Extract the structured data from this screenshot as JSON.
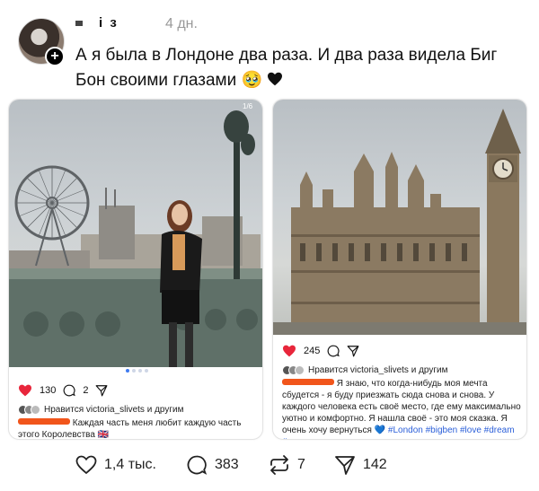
{
  "post": {
    "username": "і з",
    "time": "4 дн.",
    "text": "А я была в Лондоне два раза. И два раза видела Биг Бон своими глазами 🥹"
  },
  "left_card": {
    "likes": "130",
    "comments": "2",
    "liked_by": "Нравится victoria_slivets и другим",
    "caption": "Каждая часть меня любит каждую часть этого Королевства 🇬🇧",
    "photo_counter": "1/6"
  },
  "right_card": {
    "likes": "245",
    "liked_by": "Нравится victoria_slivets и другим",
    "caption": "Я знаю, что когда-нибудь моя мечта сбудется - я буду приезжать сюда снова и снова. У каждого человека есть своё место, где ему максимально уютно и комфортно. Я нашла своё - это моя сказка. Я очень хочу вернуться 💙",
    "tags": "#London #bigben #love #dream #vsco"
  },
  "footer": {
    "likes": "1,4 тыс.",
    "comments": "383",
    "reposts": "7",
    "shares": "142"
  },
  "colors": {
    "heart_red": "#e8263b",
    "redaction": "#f1551b",
    "hashtag": "#2b5fd9"
  }
}
